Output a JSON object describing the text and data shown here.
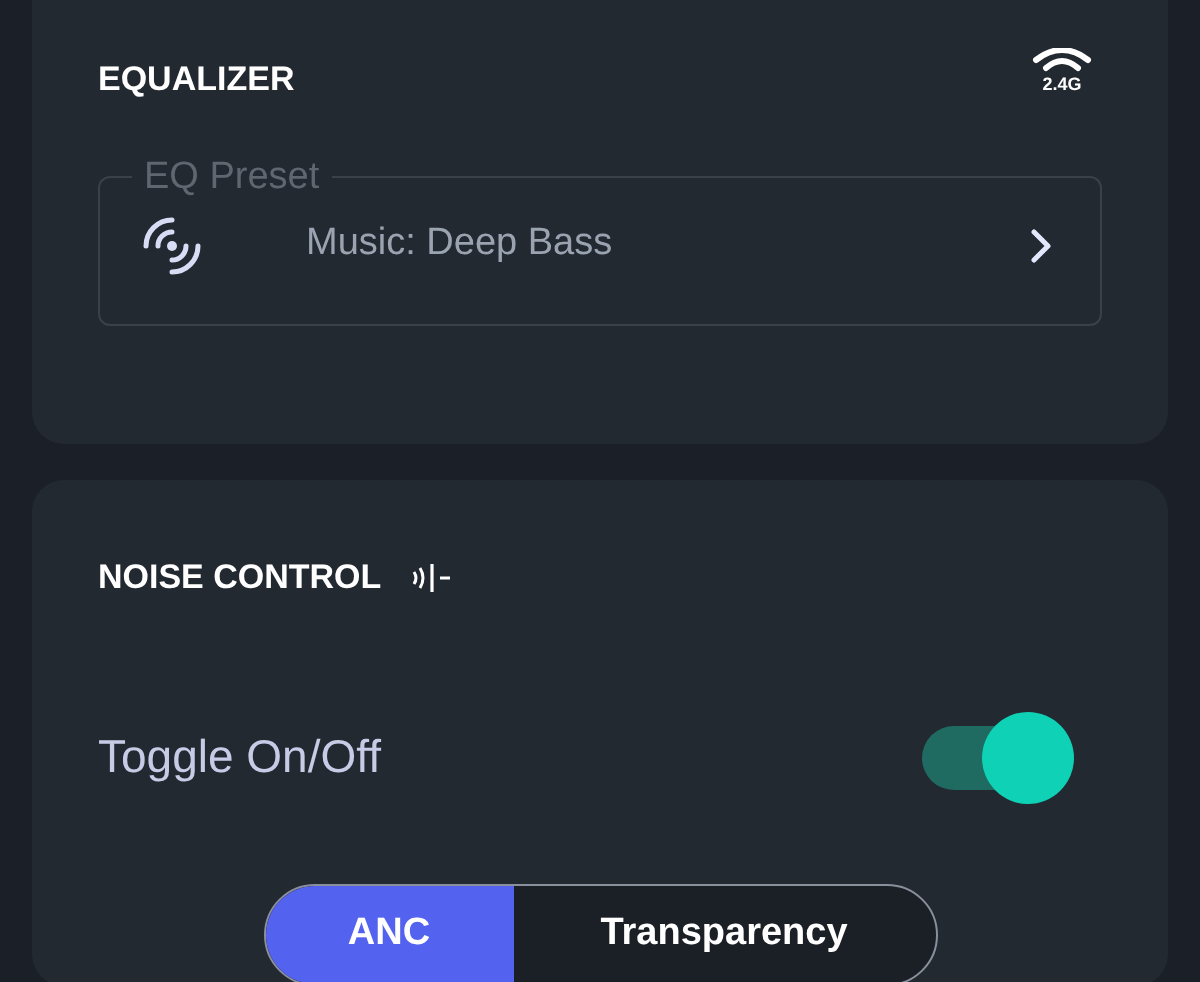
{
  "equalizer": {
    "title": "EQUALIZER",
    "band": "2.4G",
    "preset": {
      "label": "EQ Preset",
      "value": "Music: Deep Bass"
    }
  },
  "noise_control": {
    "title": "NOISE CONTROL",
    "toggle": {
      "label": "Toggle On/Off",
      "on": true
    },
    "modes": [
      {
        "label": "ANC",
        "selected": true
      },
      {
        "label": "Transparency",
        "selected": false
      }
    ]
  }
}
